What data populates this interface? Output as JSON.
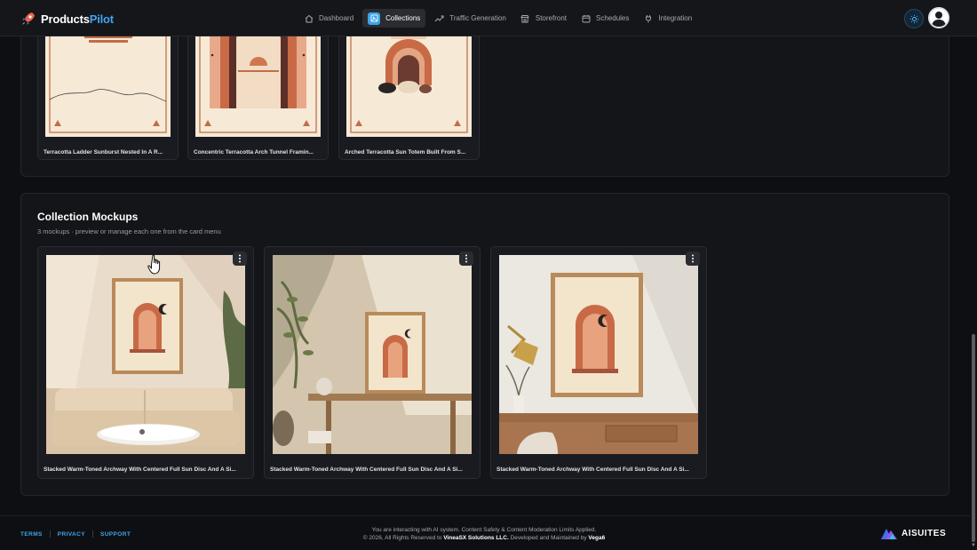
{
  "brand": {
    "name_part1": "Products",
    "name_part2": "Pilot",
    "accent": "#3fa5f0"
  },
  "nav": {
    "items": [
      {
        "label": "Dashboard",
        "icon": "home-icon",
        "active": false
      },
      {
        "label": "Collections",
        "icon": "collections-icon",
        "active": true
      },
      {
        "label": "Traffic Generation",
        "icon": "trend-icon",
        "active": false
      },
      {
        "label": "Storefront",
        "icon": "store-icon",
        "active": false
      },
      {
        "label": "Schedules",
        "icon": "calendar-icon",
        "active": false
      },
      {
        "label": "Integration",
        "icon": "plug-icon",
        "active": false
      }
    ]
  },
  "header_actions": {
    "theme_icon": "sun-icon",
    "avatar_icon": "user-avatar-icon"
  },
  "designs": {
    "cards": [
      {
        "title": "Terracotta Ladder Sunburst Nested In A R..."
      },
      {
        "title": "Concentric Terracotta Arch Tunnel Framin..."
      },
      {
        "title": "Arched Terracotta Sun Totem Built From S..."
      }
    ]
  },
  "mockups": {
    "title": "Collection Mockups",
    "subtitle": "3 mockups · preview or manage each one from the card menu",
    "cards": [
      {
        "title": "Stacked Warm-Toned Archway With Centered Full Sun Disc And A Si...",
        "menu_icon": "kebab-menu-icon"
      },
      {
        "title": "Stacked Warm-Toned Archway With Centered Full Sun Disc And A Si...",
        "menu_icon": "kebab-menu-icon"
      },
      {
        "title": "Stacked Warm-Toned Archway With Centered Full Sun Disc And A Si...",
        "menu_icon": "kebab-menu-icon"
      }
    ]
  },
  "footer": {
    "links": {
      "terms": "TERMS",
      "privacy": "PRIVACY",
      "support": "SUPPORT"
    },
    "line1": "You are interacting with AI system. Content Safety & Content Moderation Limits Applied.",
    "line2_prefix": "© 2026, All Rights Reserved to ",
    "line2_company": "VineaSX Solutions LLC.",
    "line2_middle": " Developed and Maintained by ",
    "line2_dev": "Vega6",
    "brand": "AISUITES"
  },
  "colors": {
    "background": "#0e0f12",
    "panel": "#141519",
    "terracotta": "#d0774f",
    "cream": "#f6ead6"
  }
}
